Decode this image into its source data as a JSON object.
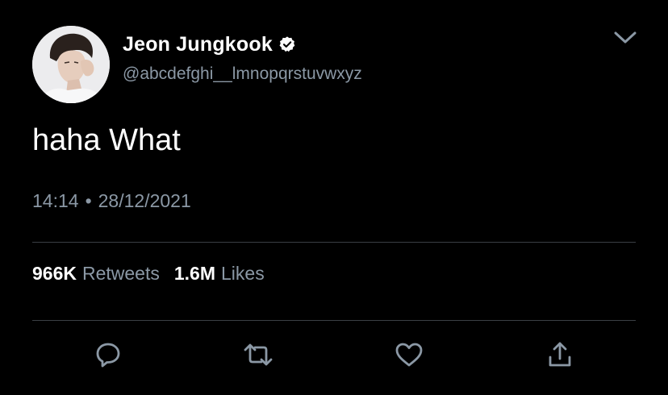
{
  "tweet": {
    "display_name": "Jeon Jungkook",
    "handle": "@abcdefghi__lmnopqrstuvwxyz",
    "text": "haha What",
    "time": "14:14",
    "separator": "•",
    "date": "28/12/2021",
    "stats": {
      "retweets_count": "966K",
      "retweets_label": "Retweets",
      "likes_count": "1.6M",
      "likes_label": "Likes"
    }
  },
  "icons": {
    "verified": "verified-badge-icon",
    "menu": "chevron-down-icon",
    "reply": "reply-icon",
    "retweet": "retweet-icon",
    "like": "heart-icon",
    "share": "share-icon"
  },
  "colors": {
    "background": "#000000",
    "primary_text": "#ffffff",
    "secondary_text": "#8b98a5",
    "divider": "#3a3f45",
    "icon": "#8b98a5"
  }
}
